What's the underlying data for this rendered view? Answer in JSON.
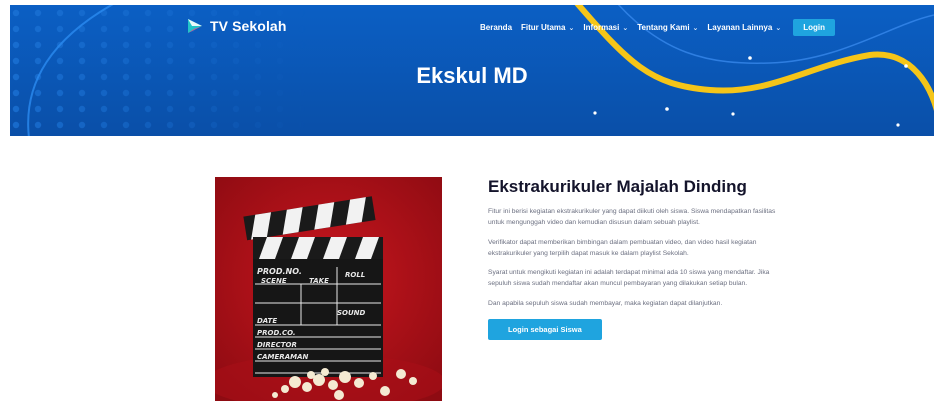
{
  "header": {
    "brand_name": "TV Sekolah",
    "nav": [
      {
        "label": "Beranda",
        "has_dropdown": false
      },
      {
        "label": "Fitur Utama",
        "has_dropdown": true
      },
      {
        "label": "Informasi",
        "has_dropdown": true
      },
      {
        "label": "Tentang Kami",
        "has_dropdown": true
      },
      {
        "label": "Layanan Lainnya",
        "has_dropdown": true
      }
    ],
    "login_label": "Login",
    "page_title": "Ekskul MD"
  },
  "clapperboard": {
    "prod_no": "PROD.NO.",
    "scene": "SCENE",
    "take": "TAKE",
    "roll": "ROLL",
    "date": "DATE",
    "sound": "SOUND",
    "prod_co": "PROD.CO.",
    "director": "DIRECTOR",
    "cameraman": "CAMERAMAN"
  },
  "main": {
    "heading": "Ekstrakurikuler Majalah Dinding",
    "paragraphs": [
      "Fitur ini berisi kegiatan ekstrakurikuler yang dapat diikuti oleh siswa. Siswa mendapatkan fasilitas untuk mengunggah video dan kemudian disusun dalam sebuah playlist.",
      "Verifikator dapat memberikan bimbingan dalam pembuatan video, dan video hasil kegiatan ekstrakurikuler yang terpilih dapat masuk ke dalam playlist Sekolah.",
      "Syarat untuk mengikuti kegiatan ini adalah terdapat minimal ada 10 siswa yang mendaftar. Jika sepuluh siswa sudah mendaftar akan muncul pembayaran yang dilakukan setiap bulan.",
      "Dan apabila sepuluh siswa sudah membayar, maka kegiatan dapat dilanjutkan."
    ],
    "cta_label": "Login sebagai Siswa"
  },
  "colors": {
    "hero_blue": "#0b5fc4",
    "accent_yellow": "#f5c518",
    "button_blue": "#1fa4df",
    "heading_dark": "#14142b",
    "body_text": "#6b6f80",
    "image_red": "#b4121a"
  },
  "icons": {
    "logo": "tv-sekolah-logo-icon",
    "dropdown": "chevron-down-icon"
  }
}
